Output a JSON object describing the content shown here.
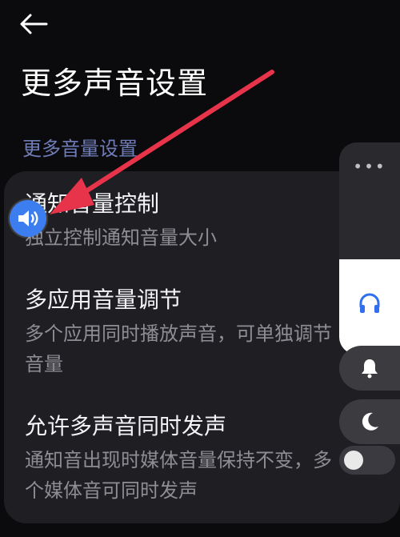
{
  "header": {
    "back_icon": "arrow-left-icon",
    "title": "更多声音设置"
  },
  "section": {
    "title": "更多音量设置"
  },
  "items": [
    {
      "title": "通知音量控制",
      "desc": "独立控制通知音量大小",
      "toggle": true
    },
    {
      "title": "多应用音量调节",
      "desc": "多个应用同时播放声音，可单独调节音量",
      "toggle": true
    },
    {
      "title": "允许多声音同时发声",
      "desc": "通知音出现时媒体音量保持不变，多个媒体音可同时发声",
      "toggle": false
    }
  ],
  "volume_panel": {
    "more_label": "•••",
    "level": 0.45,
    "stream_icon": "headphones-icon",
    "buttons": [
      "bell-icon",
      "moon-icon"
    ]
  },
  "floating_button": {
    "icon": "speaker-icon"
  },
  "colors": {
    "background": "#0b0b0d",
    "card": "#1f1f23",
    "accent": "#2f6ff0",
    "section_title": "#6f7cb7",
    "annotation_arrow": "#e8344a"
  }
}
